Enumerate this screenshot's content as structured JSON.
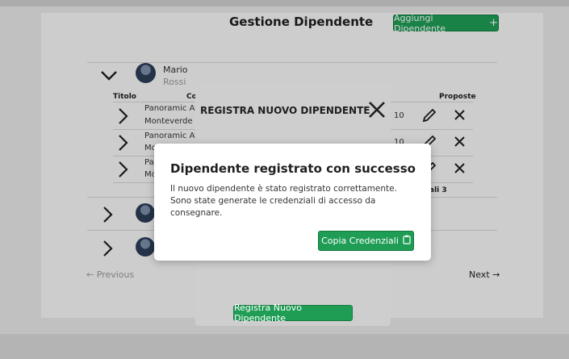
{
  "page": {
    "title": "Gestione Dipendente",
    "add_button_label": "Aggiungi Dipendente",
    "add_button_icon": "plus-icon"
  },
  "employees": [
    {
      "first_name": "Mario",
      "last_name": "Rossi",
      "expanded": true
    },
    {
      "expanded": false
    },
    {
      "expanded": false
    }
  ],
  "table": {
    "columns": [
      "Titolo",
      "Co",
      "Proposte"
    ],
    "rows": [
      {
        "title_line1": "Panoramic At",
        "title_line2": "Monteverde V",
        "value": "10"
      },
      {
        "title_line1": "Panoramic At",
        "title_line2": "Mo",
        "value": "10"
      },
      {
        "title_line1": "Pa",
        "title_line2": "Mo",
        "value": ""
      }
    ],
    "total_label": "ali 3"
  },
  "pagination": {
    "previous_label": "Previous",
    "next_label": "Next"
  },
  "register_modal": {
    "title": "REGISTRA NUOVO DIPENDENTE",
    "submit_label": "Registra Nuovo Dipendente"
  },
  "success_dialog": {
    "title": "Dipendente registrato con successo",
    "message": "Il nuovo dipendente è stato registrato correttamente. Sono state generate le credenziali di accesso da consegnare.",
    "copy_button_label": "Copia Credenziali",
    "copy_icon": "clipboard-icon"
  },
  "colors": {
    "accent_green": "#1f9d55",
    "overlay": "rgba(0,0,0,0.17)"
  }
}
